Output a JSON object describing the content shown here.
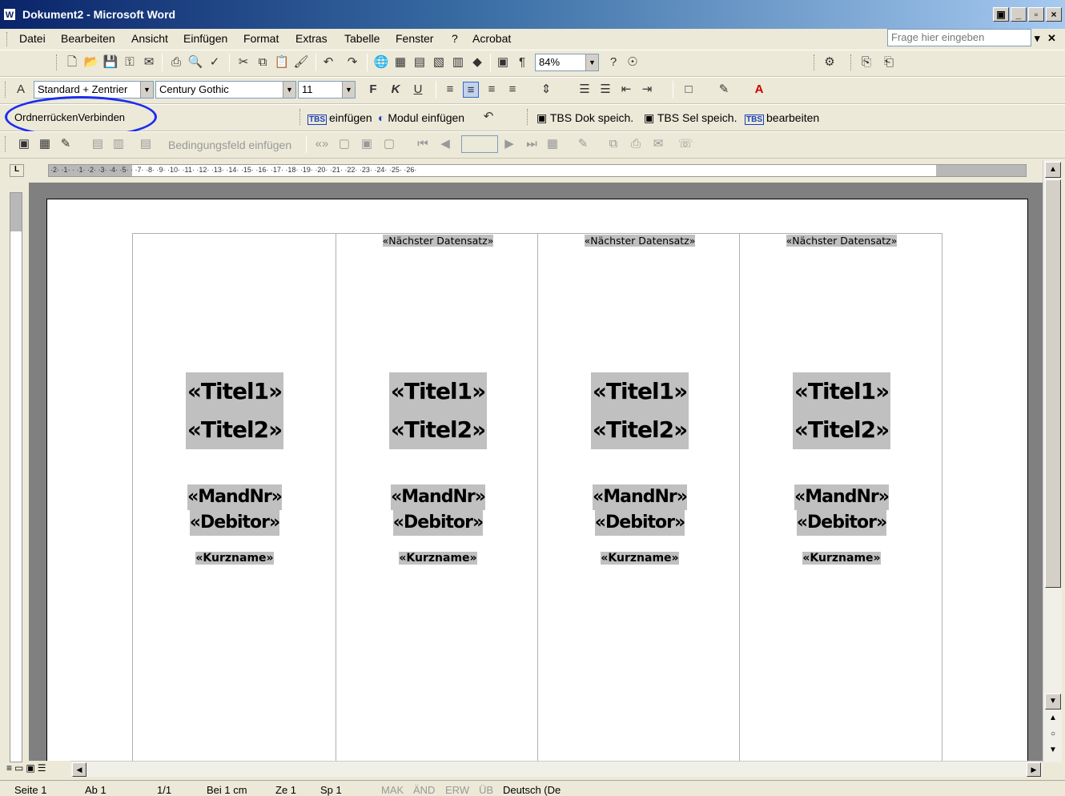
{
  "window": {
    "title": "Dokument2 - Microsoft Word",
    "app_icon": "W"
  },
  "menu": {
    "items": [
      "Datei",
      "Bearbeiten",
      "Ansicht",
      "Einfügen",
      "Format",
      "Extras",
      "Tabelle",
      "Fenster",
      "?",
      "Acrobat"
    ],
    "help_placeholder": "Frage hier eingeben"
  },
  "formatting": {
    "style": "Standard + Zentrier",
    "font": "Century Gothic",
    "size": "11",
    "zoom": "84%"
  },
  "custom_toolbar": {
    "ordner_label": "OrdnerrückenVerbinden",
    "tbs_einfuegen": "einfügen",
    "modul_einfuegen": "Modul einfügen",
    "dok_speich": "TBS Dok speich.",
    "sel_speich": "TBS Sel speich.",
    "bearbeiten": "bearbeiten",
    "tbs_badge": "TBS"
  },
  "mail_merge": {
    "bedingungsfeld": "Bedingungsfeld einfügen"
  },
  "ruler": {
    "numbers": "·2· ·1· · ·1· ·2· ·3· ·4· ·5· · ·7· ·8· ·9· ·10· ·11· ·12· ·13· ·14· ·15· ·16· ·17· ·18· ·19· ·20· ·21· ·22· ·23· ·24· ·25· ·26·",
    "tab_marker": "L"
  },
  "labels": [
    {
      "next": "",
      "title1": "«Titel1»",
      "title2": "«Titel2»",
      "mandnr": "«MandNr»",
      "debitor": "«Debitor»",
      "kurzname": "«Kurzname»"
    },
    {
      "next": "«Nächster Datensatz»",
      "title1": "«Titel1»",
      "title2": "«Titel2»",
      "mandnr": "«MandNr»",
      "debitor": "«Debitor»",
      "kurzname": "«Kurzname»"
    },
    {
      "next": "«Nächster Datensatz»",
      "title1": "«Titel1»",
      "title2": "«Titel2»",
      "mandnr": "«MandNr»",
      "debitor": "«Debitor»",
      "kurzname": "«Kurzname»"
    },
    {
      "next": "«Nächster Datensatz»",
      "title1": "«Titel1»",
      "title2": "«Titel2»",
      "mandnr": "«MandNr»",
      "debitor": "«Debitor»",
      "kurzname": "«Kurzname»"
    }
  ],
  "status": {
    "seite": "Seite 1",
    "ab": "Ab 1",
    "pages": "1/1",
    "bei": "Bei 1 cm",
    "ze": "Ze 1",
    "sp": "Sp 1",
    "mak": "MAK",
    "aend": "ÄND",
    "erw": "ERW",
    "ueb": "ÜB",
    "lang": "Deutsch (De"
  },
  "colors": {
    "title_gradient_start": "#0a246a",
    "field_shading": "#c0c0c0",
    "highlight_oval": "#1c2cf0"
  }
}
